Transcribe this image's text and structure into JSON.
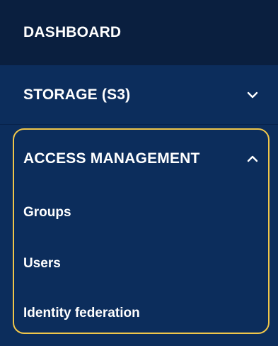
{
  "nav": {
    "dashboard": {
      "label": "DASHBOARD"
    },
    "storage": {
      "label": "STORAGE (S3)",
      "icon": "chevron-down-icon"
    },
    "access_management": {
      "label": "ACCESS MANAGEMENT",
      "icon": "chevron-up-icon",
      "expanded": true,
      "items": [
        {
          "label": "Groups"
        },
        {
          "label": "Users"
        },
        {
          "label": "Identity federation"
        }
      ]
    }
  },
  "colors": {
    "nav_background": "#0c2d5c",
    "dashboard_background": "#0a1f3f",
    "highlight_outline": "#f0c64a",
    "text": "#ffffff"
  }
}
